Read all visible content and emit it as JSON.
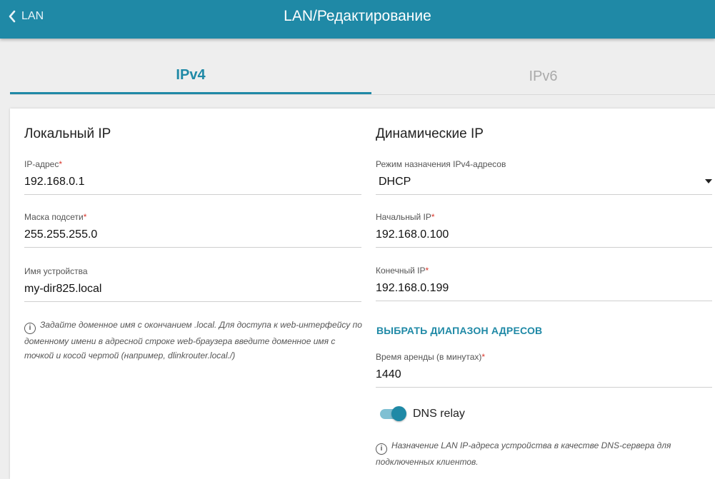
{
  "header": {
    "back_label": "LAN",
    "title": "LAN/Редактирование"
  },
  "tabs": [
    {
      "label": "IPv4",
      "active": true
    },
    {
      "label": "IPv6",
      "active": false
    }
  ],
  "local_ip": {
    "title": "Локальный IP",
    "ip_label": "IP-адрес",
    "ip_value": "192.168.0.1",
    "mask_label": "Маска подсети",
    "mask_value": "255.255.255.0",
    "device_name_label": "Имя устройства",
    "device_name_value": "my-dir825.local",
    "hint_icon": "info-icon",
    "hint": "Задайте доменное имя с окончанием .local. Для доступа к web-интерфейсу по доменному имени в адресной строке web-браузера введите доменное имя с точкой и косой чертой (например, dlinkrouter.local./)"
  },
  "dynamic_ip": {
    "title": "Динамические IP",
    "mode_label": "Режим назначения IPv4-адресов",
    "mode_value": "DHCP",
    "start_ip_label": "Начальный IP",
    "start_ip_value": "192.168.0.100",
    "end_ip_label": "Конечный IP",
    "end_ip_value": "192.168.0.199",
    "range_button": "ВЫБРАТЬ ДИАПАЗОН АДРЕСОВ",
    "lease_label": "Время аренды (в минутах)",
    "lease_value": "1440",
    "dns_relay_label": "DNS relay",
    "dns_relay_on": true,
    "dns_hint_icon": "info-icon",
    "dns_hint": "Назначение LAN IP-адреса устройства в качестве DNS-сервера для подключенных клиентов."
  },
  "required_mark": "*",
  "colors": {
    "accent": "#1f89a6",
    "required": "#d9362b",
    "background": "#eeeeee"
  }
}
